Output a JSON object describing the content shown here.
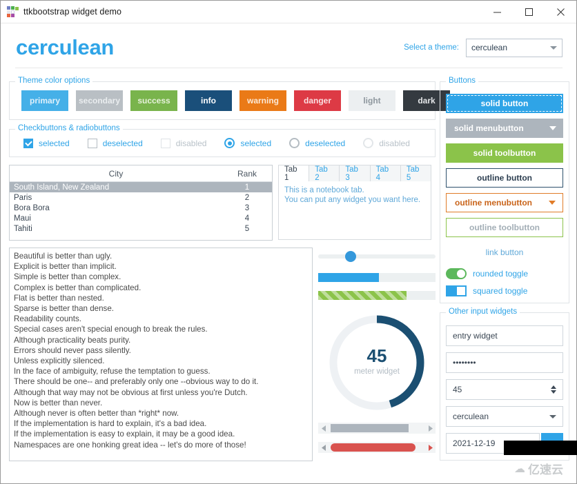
{
  "window": {
    "title": "ttkbootstrap widget demo",
    "icon": "app-grid-icon",
    "minimize": "─",
    "maximize": "□",
    "close": "✕"
  },
  "header": {
    "brand": "cerculean",
    "theme_label": "Select a theme:",
    "theme_value": "cerculean",
    "theme_options": [
      "cerculean"
    ]
  },
  "theme_colors": {
    "title": "Theme color options",
    "swatches": [
      {
        "label": "primary",
        "bg": "#45b0e8",
        "fg": "#dff0fb"
      },
      {
        "label": "secondary",
        "bg": "#b9bfc4",
        "fg": "#eaedef"
      },
      {
        "label": "success",
        "bg": "#79b44c",
        "fg": "#e6f1da"
      },
      {
        "label": "info",
        "bg": "#1a4f7a",
        "fg": "#ffffff"
      },
      {
        "label": "warning",
        "bg": "#ea7a17",
        "fg": "#fbe8d5"
      },
      {
        "label": "danger",
        "bg": "#dd3a45",
        "fg": "#fadfe1"
      },
      {
        "label": "light",
        "bg": "#eceff1",
        "fg": "#8e979e"
      },
      {
        "label": "dark",
        "bg": "#343a40",
        "fg": "#e4e6e8"
      }
    ]
  },
  "checks": {
    "title": "Checkbuttons & radiobuttons",
    "items": [
      {
        "type": "check",
        "label": "selected",
        "state": "on"
      },
      {
        "type": "check",
        "label": "deselected",
        "state": "off"
      },
      {
        "type": "check",
        "label": "disabled",
        "state": "disabled"
      },
      {
        "type": "radio",
        "label": "selected",
        "state": "on"
      },
      {
        "type": "radio",
        "label": "deselected",
        "state": "off"
      },
      {
        "type": "radio",
        "label": "disabled",
        "state": "disabled"
      }
    ]
  },
  "tree": {
    "columns": [
      "City",
      "Rank"
    ],
    "rows": [
      {
        "city": "South Island, New Zealand",
        "rank": "1",
        "selected": true
      },
      {
        "city": "Paris",
        "rank": "2",
        "selected": false
      },
      {
        "city": "Bora Bora",
        "rank": "3",
        "selected": false
      },
      {
        "city": "Maui",
        "rank": "4",
        "selected": false
      },
      {
        "city": "Tahiti",
        "rank": "5",
        "selected": false
      }
    ]
  },
  "notebook": {
    "tabs": [
      "Tab 1",
      "Tab 2",
      "Tab 3",
      "Tab 4",
      "Tab 5"
    ],
    "active_index": 0,
    "pane_line1": "This is a notebook tab.",
    "pane_line2": "You can put any widget you want here."
  },
  "textbox": {
    "lines": [
      "Beautiful is better than ugly.",
      "Explicit is better than implicit.",
      "Simple is better than complex.",
      "Complex is better than complicated.",
      "Flat is better than nested.",
      "Sparse is better than dense.",
      "Readability counts.",
      "Special cases aren't special enough to break the rules.",
      "Although practicality beats purity.",
      "Errors should never pass silently.",
      "Unless explicitly silenced.",
      "In the face of ambiguity, refuse the temptation to guess.",
      "There should be one-- and preferably only one --obvious way to do it.",
      "Although that way may not be obvious at first unless you're Dutch.",
      "Now is better than never.",
      "Although never is often better than *right* now.",
      "If the implementation is hard to explain, it's a bad idea.",
      "If the implementation is easy to explain, it may be a good idea.",
      "Namespaces are one honking great idea -- let's do more of those!"
    ]
  },
  "middle": {
    "scale_value": 25,
    "progress_solid_value": 52,
    "progress_striped_value": 75,
    "meter_value": "45",
    "meter_label": "meter widget",
    "meter_percent": 45,
    "scroll_left_arrow": "◂",
    "scroll_right_arrow": "▸",
    "scrollbar_square_fraction": 84,
    "scrollbar_round_fraction": 92
  },
  "buttons": {
    "title": "Buttons",
    "solid": "solid button",
    "solid_menu": "solid menubutton",
    "solid_tool": "solid toolbutton",
    "outline": "outline button",
    "outline_menu": "outline menubutton",
    "outline_tool": "outline toolbutton",
    "link": "link button",
    "rounded_toggle": "rounded toggle",
    "squared_toggle": "squared toggle"
  },
  "other_inputs": {
    "title": "Other input widgets",
    "entry_value": "entry widget",
    "password_value": "••••••••",
    "spinbox_value": "45",
    "combobox_value": "cerculean",
    "date_value": "2021-12-19",
    "date_button": ""
  },
  "overlay": {
    "watermark_text": "亿速云",
    "watermark_icon": "cloud-icon"
  }
}
